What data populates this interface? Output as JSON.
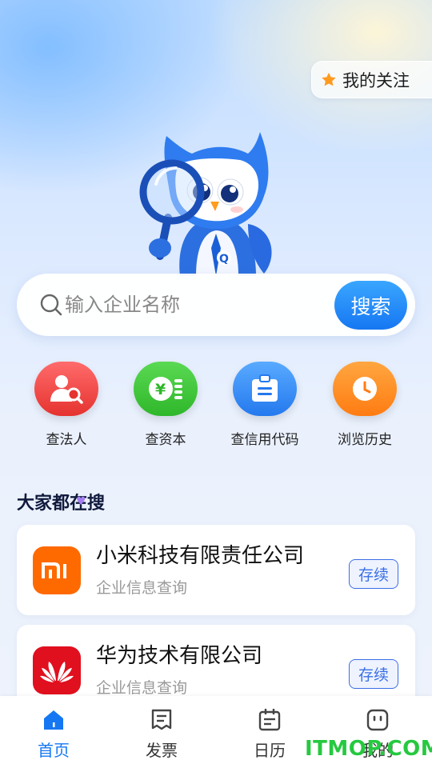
{
  "header": {
    "follow_label": "我的关注"
  },
  "search": {
    "placeholder": "输入企业名称",
    "button_label": "搜索"
  },
  "quick_actions": [
    {
      "label": "查法人",
      "icon": "person-search-icon",
      "color": "#f04848"
    },
    {
      "label": "查资本",
      "icon": "yuan-coins-icon",
      "color": "#3dc43a"
    },
    {
      "label": "查信用代码",
      "icon": "id-badge-icon",
      "color": "#2f8ff4"
    },
    {
      "label": "浏览历史",
      "icon": "clock-icon",
      "color": "#ff8a1e"
    }
  ],
  "section": {
    "title": "大家都在搜"
  },
  "companies": [
    {
      "name": "小米科技有限责任公司",
      "subtitle": "企业信息查询",
      "tag": "存续",
      "logo": "mi-logo",
      "logo_color": "#ff6a00"
    },
    {
      "name": "华为技术有限公司",
      "subtitle": "企业信息查询",
      "tag": "存续",
      "logo": "huawei-logo",
      "logo_color": "#e0101e"
    }
  ],
  "tabbar": [
    {
      "label": "首页",
      "icon": "home-icon",
      "active": true
    },
    {
      "label": "发票",
      "icon": "invoice-icon",
      "active": false
    },
    {
      "label": "日历",
      "icon": "calendar-icon",
      "active": false
    },
    {
      "label": "我的",
      "icon": "profile-icon",
      "active": false
    }
  ],
  "watermark": "ITMOP.COM",
  "colors": {
    "accent": "#1677f2",
    "tag_border": "#3b6fe6"
  }
}
